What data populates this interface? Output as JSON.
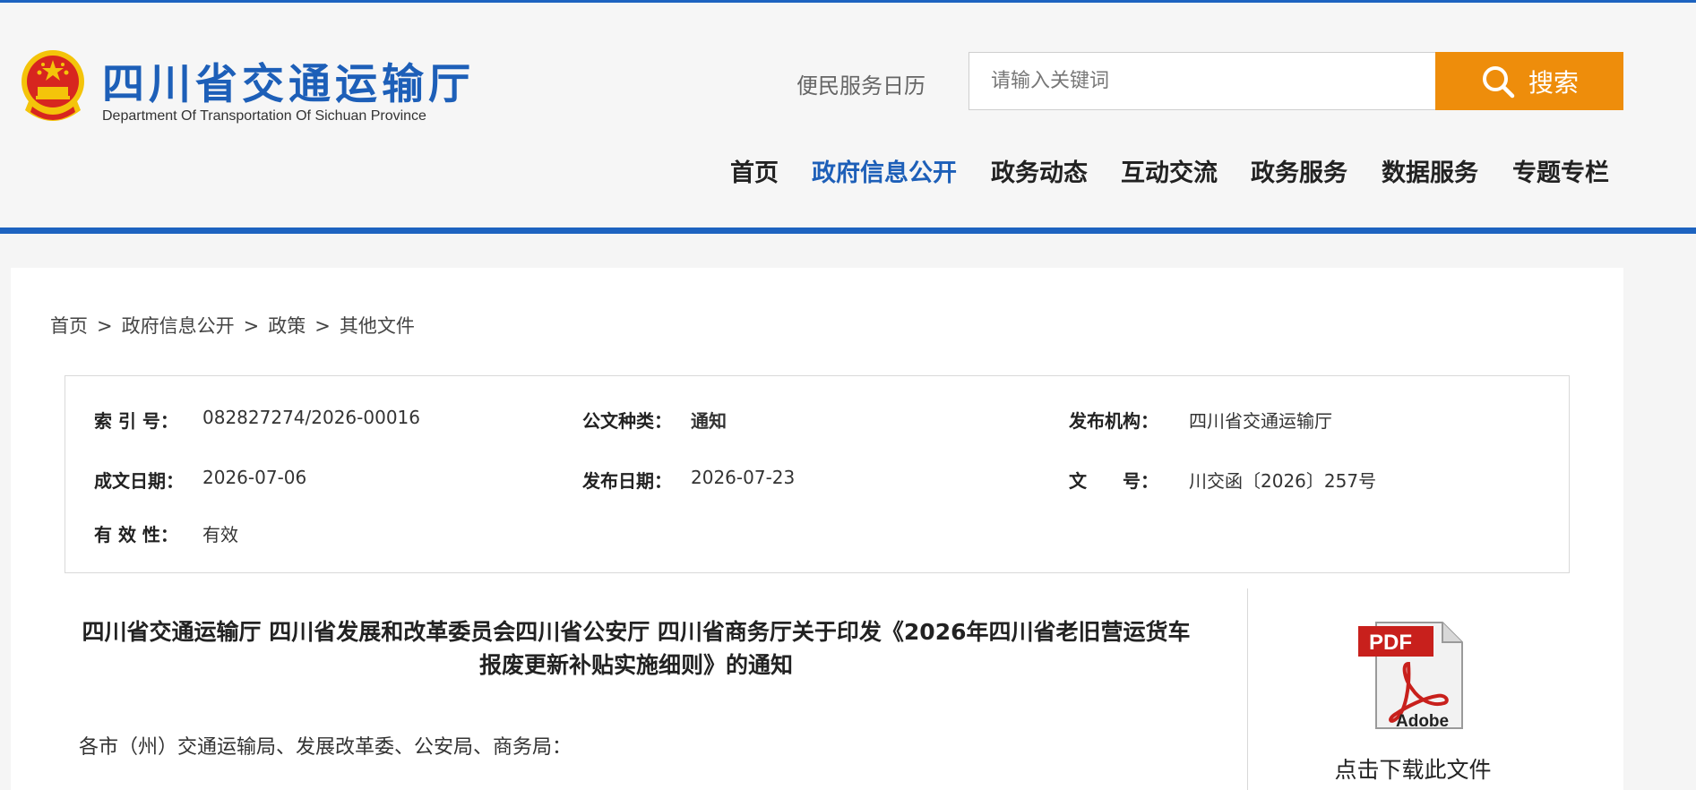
{
  "header": {
    "title": "四川省交通运输厅",
    "subtitle": "Department Of Transportation Of Sichuan Province",
    "calendar_link": "便民服务日历",
    "search_placeholder": "请输入关键词",
    "search_button": "搜索"
  },
  "nav": {
    "items": [
      {
        "label": "首页"
      },
      {
        "label": "政府信息公开"
      },
      {
        "label": "政务动态"
      },
      {
        "label": "互动交流"
      },
      {
        "label": "政务服务"
      },
      {
        "label": "数据服务"
      },
      {
        "label": "专题专栏"
      }
    ],
    "active_index": 1
  },
  "breadcrumb": {
    "items": [
      "首页",
      "政府信息公开",
      "政策",
      "其他文件"
    ],
    "separator": ">"
  },
  "meta": {
    "index_label": "索 引 号：",
    "index_value": "082827274/2026-00016",
    "type_label": "公文种类：",
    "type_value": "通知",
    "issuer_label": "发布机构：",
    "issuer_value": "四川省交通运输厅",
    "created_label": "成文日期：",
    "created_value": "2026-07-06",
    "published_label": "发布日期：",
    "published_value": "2026-07-23",
    "docno_label": "文　　号：",
    "docno_value": "川交函〔2026〕257号",
    "validity_label": "有 效 性：",
    "validity_value": "有效"
  },
  "document": {
    "title_line1": "四川省交通运输厅 四川省发展和改革委员会四川省公安厅 四川省商务厅关于印发《2026年四川省老旧营运货车",
    "title_line2": "报废更新补贴实施细则》的通知",
    "greeting": "各市（州）交通运输局、发展改革委、公安局、商务局："
  },
  "download": {
    "pdf_badge": "PDF",
    "brand": "Adobe",
    "label": "点击下载此文件"
  },
  "colors": {
    "primary_blue": "#1d5fb8",
    "search_orange": "#ee8d0b",
    "emblem_red": "#d7261f",
    "emblem_gold": "#f4c40a"
  },
  "icons": {
    "logo": "national-emblem-icon",
    "search": "search-icon",
    "pdf": "pdf-file-icon"
  }
}
